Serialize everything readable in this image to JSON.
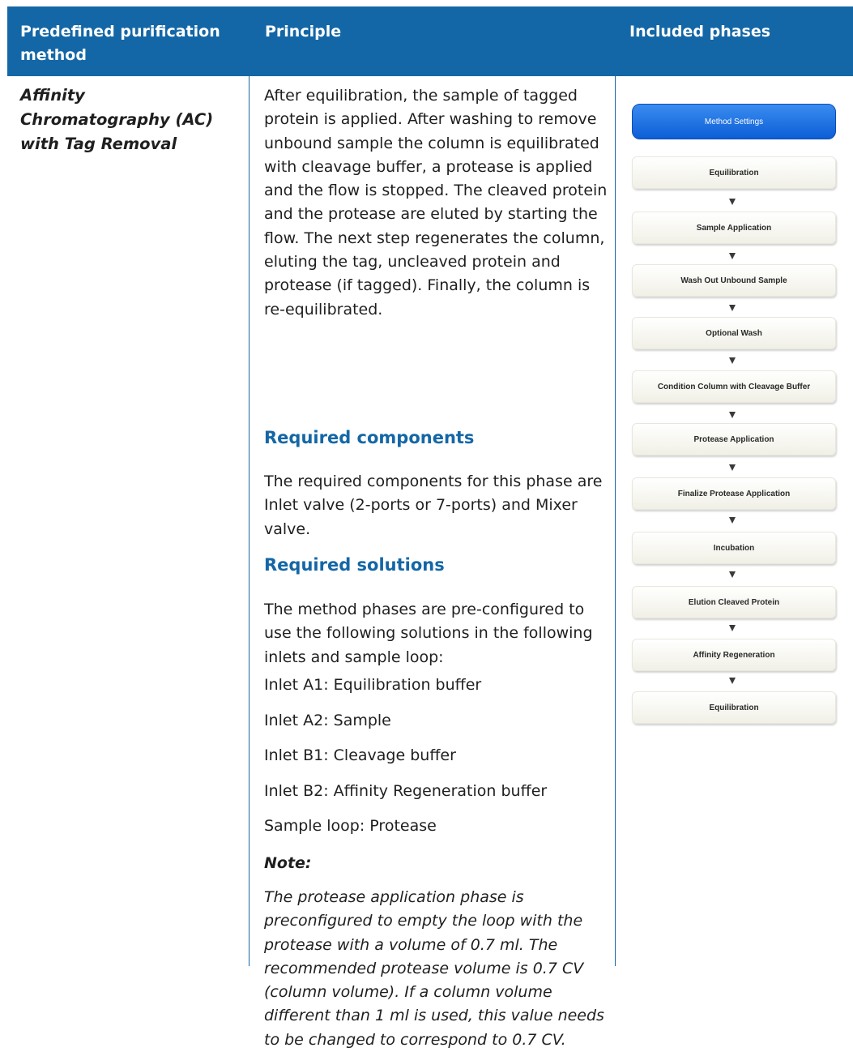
{
  "headers": {
    "col1": "Predefined purification method",
    "col2": "Principle",
    "col3": "Included phases"
  },
  "method": "Affinity Chromatography (AC) with Tag Removal",
  "principle": "After equilibration, the sample of tagged protein is applied. After washing to remove unbound sample the column is equilibrated with cleavage buffer, a protease is applied and the flow is stopped. The cleaved protein and the protease are eluted by starting the flow. The next step regenerates the column, eluting the tag, uncleaved protein and protease (if tagged). Finally, the column is re-equilibrated.",
  "required_components": {
    "heading": "Required components",
    "text": "The required components for this phase are Inlet valve (2-ports or 7-ports) and Mixer valve."
  },
  "required_solutions": {
    "heading": "Required solutions",
    "text": "The method phases are pre-configured to use the following solutions in the following inlets and sample loop:",
    "items": [
      "Inlet A1: Equilibration buffer",
      "Inlet A2: Sample",
      "Inlet B1: Cleavage buffer",
      "Inlet B2: Affinity Regeneration buffer",
      "Sample loop: Protease"
    ]
  },
  "note": {
    "heading": "Note:",
    "text": "The protease application phase is preconfigured to empty the loop with the protease with a volume of 0.7 ml. The recommended protease volume is 0.7 CV (column volume). If a column volume different than 1 ml is used, this value needs to be changed to correspond to 0.7 CV."
  },
  "diagram": {
    "method_settings": "Method Settings",
    "phases": [
      "Equilibration",
      "Sample Application",
      "Wash Out Unbound Sample",
      "Optional Wash",
      "Condition Column with Cleavage Buffer",
      "Protease Application",
      "Finalize Protease Application",
      "Incubation",
      "Elution Cleaved Protein",
      "Affinity Regeneration",
      "Equilibration"
    ]
  }
}
